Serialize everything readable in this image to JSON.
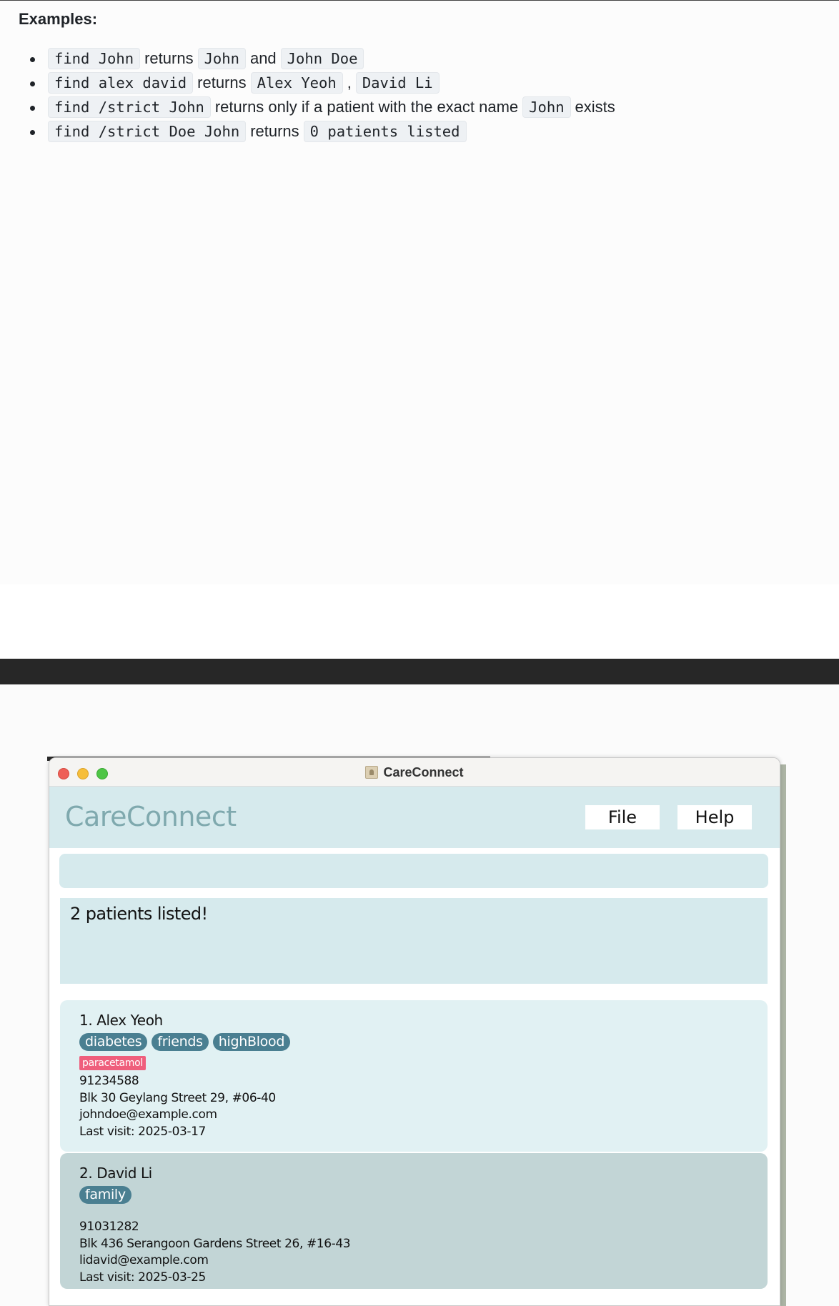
{
  "doc": {
    "heading": "Examples:",
    "examples": [
      {
        "parts": [
          {
            "code": "find John"
          },
          {
            "text": "returns"
          },
          {
            "code": "John"
          },
          {
            "text": "and"
          },
          {
            "code": "John Doe"
          }
        ]
      },
      {
        "parts": [
          {
            "code": "find alex david"
          },
          {
            "text": "returns"
          },
          {
            "code": "Alex Yeoh"
          },
          {
            "text": ","
          },
          {
            "code": "David Li"
          }
        ]
      },
      {
        "parts": [
          {
            "code": "find /strict John"
          },
          {
            "text": "returns only if a patient with the exact name"
          },
          {
            "code": "John"
          },
          {
            "text": "exists"
          }
        ]
      },
      {
        "parts": [
          {
            "code": "find /strict Doe John"
          },
          {
            "text": "returns"
          },
          {
            "code": "0 patients listed"
          }
        ]
      }
    ]
  },
  "window": {
    "title": "CareConnect",
    "app_name": "CareConnect",
    "menu": {
      "file_label": "File",
      "help_label": "Help"
    },
    "command_input": {
      "value": ""
    },
    "result_text": "2 patients listed!"
  },
  "patients": [
    {
      "name": "1. Alex Yeoh",
      "tags": [
        "diabetes",
        "friends",
        "highBlood"
      ],
      "medications": [
        "paracetamol"
      ],
      "phone": "91234588",
      "address": "Blk 30 Geylang Street 29, #06-40",
      "email": "johndoe@example.com",
      "last_visit": "Last visit: 2025-03-17"
    },
    {
      "name": "2. David Li",
      "tags": [
        "family"
      ],
      "medications": [],
      "phone": "91031282",
      "address": "Blk 436 Serangoon Gardens Street 26, #16-43",
      "email": "lidavid@example.com",
      "last_visit": "Last visit: 2025-03-25"
    }
  ],
  "colors": {
    "tag_bg": "#4a7f91",
    "medication_bg": "#ef5e7c",
    "panel_bg": "#d6eaed",
    "selected_card_bg": "#c2d5d6"
  }
}
